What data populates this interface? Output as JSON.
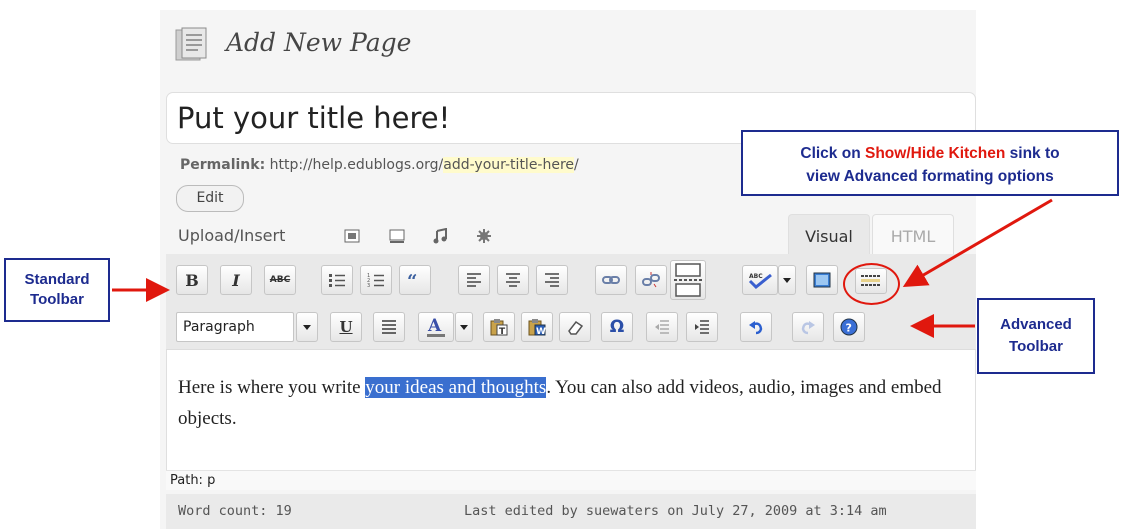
{
  "header": {
    "title": "Add New Page"
  },
  "title_input": {
    "value": "Put your title here!"
  },
  "permalink": {
    "label": "Permalink:",
    "base": "http://help.edublogs.org/",
    "slug": "add-your-title-here",
    "tail": "/",
    "edit_label": "Edit"
  },
  "upload": {
    "label": "Upload/Insert",
    "icons": [
      "image-icon",
      "gallery-icon",
      "music-icon",
      "media-icon"
    ]
  },
  "tabs": {
    "visual": "Visual",
    "html": "HTML"
  },
  "toolbar1": {
    "items": [
      "bold",
      "italic",
      "strikethrough",
      "bullet-list",
      "numbered-list",
      "blockquote",
      "align-left",
      "align-center",
      "align-right",
      "link",
      "unlink",
      "more",
      "spellcheck",
      "fullscreen",
      "kitchen-sink"
    ],
    "bold": "B",
    "italic": "I",
    "strike": "ABC"
  },
  "toolbar2": {
    "format_select": "Paragraph",
    "underline": "U",
    "omega": "Ω",
    "items": [
      "format-select",
      "underline",
      "justify",
      "text-color",
      "paste-text",
      "paste-word",
      "remove-format",
      "special-char",
      "outdent",
      "indent",
      "undo",
      "redo",
      "help"
    ]
  },
  "content": {
    "before": "Here is where you write ",
    "highlight": "your ideas and thoughts",
    "after": ".  You can also add videos, audio, images and embed objects."
  },
  "status": {
    "path": "Path: p",
    "word_count": "Word count: 19",
    "last_edited": "Last edited by suewaters on July 27, 2009 at 3:14 am"
  },
  "annotations": {
    "kitchen_pre": "Click on ",
    "kitchen_red": "Show/Hide Kitchen",
    "kitchen_post": " sink to",
    "kitchen_line2": "view Advanced formating options",
    "standard_line1": "Standard",
    "standard_line2": "Toolbar",
    "advanced_line1": "Advanced",
    "advanced_line2": "Toolbar"
  },
  "colors": {
    "annotation_blue": "#1d2b8f",
    "annotation_red": "#e0180e",
    "selection_blue": "#3a6fcf",
    "slug_highlight": "#fffbcc"
  }
}
